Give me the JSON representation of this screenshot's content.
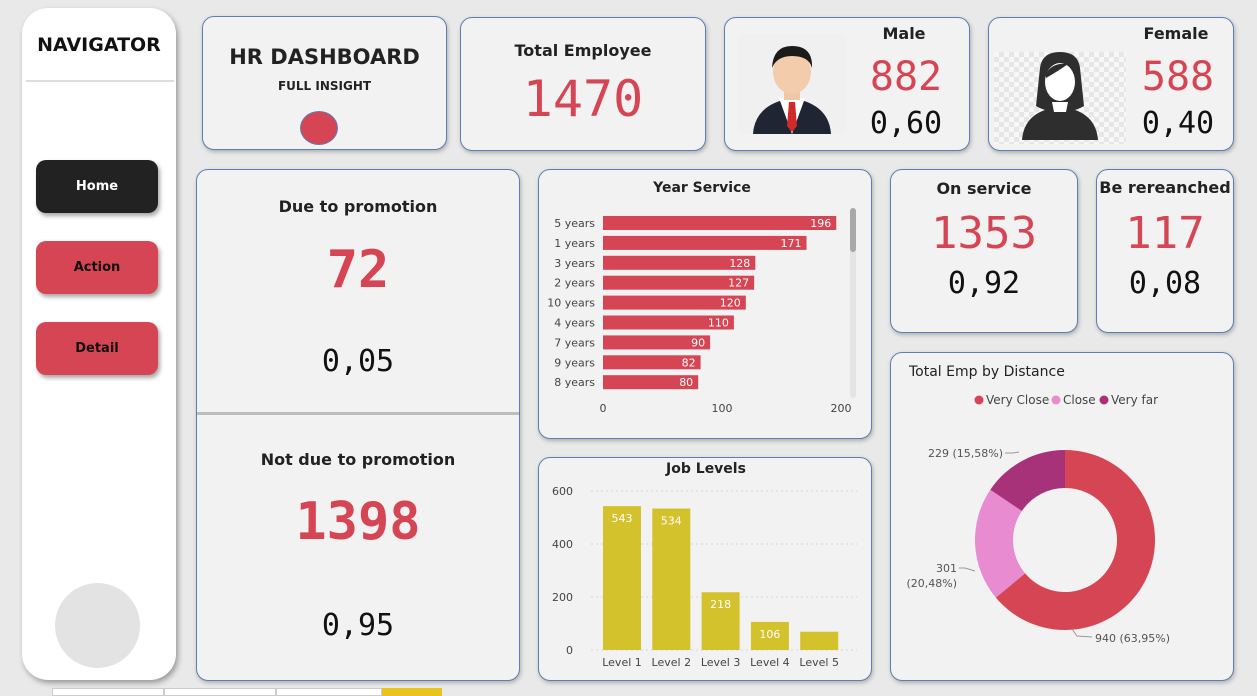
{
  "nav": {
    "title": "NAVIGATOR",
    "home": "Home",
    "action": "Action",
    "detail": "Detail"
  },
  "header": {
    "title": "HR DASHBOARD",
    "subtitle": "FULL INSIGHT"
  },
  "kpi": {
    "total_label": "Total Employee",
    "total_value": "1470",
    "male_label": "Male",
    "male_value": "882",
    "male_ratio": "0,60",
    "female_label": "Female",
    "female_value": "588",
    "female_ratio": "0,40",
    "promo_label": "Due to promotion",
    "promo_value": "72",
    "promo_ratio": "0,05",
    "notpromo_label": "Not due to promotion",
    "notpromo_value": "1398",
    "notpromo_ratio": "0,95",
    "onservice_label": "On service",
    "onservice_value": "1353",
    "onservice_ratio": "0,92",
    "reranched_label": "Be rereanched",
    "reranched_value": "117",
    "reranched_ratio": "0,08"
  },
  "colors": {
    "accent": "#d64553",
    "dark": "#222222",
    "bar_gold": "#d4c22c",
    "close": "#e98bd0",
    "very_far": "#a8327a"
  },
  "chart_data": [
    {
      "type": "bar",
      "orientation": "horizontal",
      "title": "Year Service",
      "categories": [
        "5 years",
        "1 years",
        "3 years",
        "2 years",
        "10 years",
        "4 years",
        "7 years",
        "9 years",
        "8 years"
      ],
      "values": [
        196,
        171,
        128,
        127,
        120,
        110,
        90,
        82,
        80
      ],
      "xlim": [
        0,
        200
      ],
      "xticks": [
        "0",
        "100",
        "200"
      ],
      "color": "#d64553"
    },
    {
      "type": "bar",
      "title": "Job Levels",
      "categories": [
        "Level 1",
        "Level 2",
        "Level 3",
        "Level 4",
        "Level 5"
      ],
      "values": [
        543,
        534,
        218,
        106,
        69
      ],
      "data_labels": [
        "543",
        "534",
        "218",
        "106",
        ""
      ],
      "ylim": [
        0,
        600
      ],
      "yticks": [
        "0",
        "200",
        "400",
        "600"
      ],
      "color": "#d4c22c"
    },
    {
      "type": "pie",
      "subtype": "donut",
      "title": "Total Emp by Distance",
      "legend_position": "top",
      "series": [
        {
          "name": "Very Close",
          "value": 940,
          "label": "940 (63,95%)",
          "color": "#d64553"
        },
        {
          "name": "Close",
          "value": 301,
          "label_line1": "301",
          "label_line2": "(20,48%)",
          "color": "#e98bd0"
        },
        {
          "name": "Very far",
          "value": 229,
          "label": "229 (15,58%)",
          "color": "#a8327a"
        }
      ]
    }
  ]
}
